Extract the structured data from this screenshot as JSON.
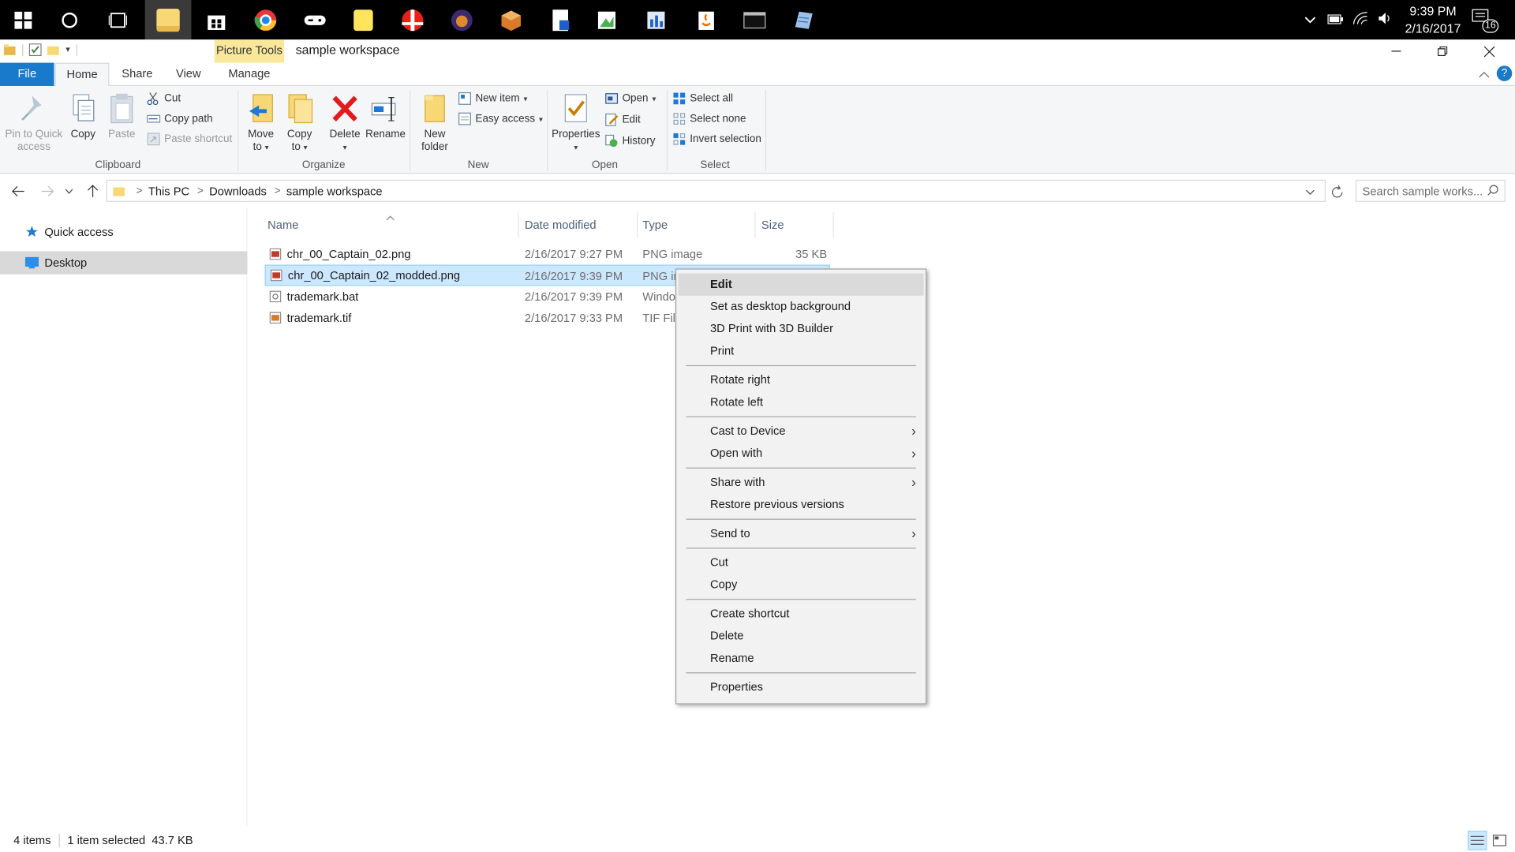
{
  "taskbar": {
    "apps": [
      {
        "icon": "windows-start-icon"
      },
      {
        "icon": "cortana-search-icon"
      },
      {
        "icon": "task-view-icon"
      },
      {
        "icon": "file-explorer-icon",
        "color": "#f8d775"
      },
      {
        "icon": "store-icon"
      },
      {
        "icon": "chrome-icon",
        "color": "#e53935"
      },
      {
        "icon": "game-controller-icon"
      },
      {
        "icon": "sticky-notes-icon",
        "color": "#ffe45c"
      },
      {
        "icon": "smash-app-icon",
        "color": "#e62117"
      },
      {
        "icon": "game-app-icon",
        "color": "#6b4aa8"
      },
      {
        "icon": "box-app-icon",
        "color": "#d97a2b"
      },
      {
        "icon": "document-app-icon"
      },
      {
        "icon": "image-editor-icon"
      },
      {
        "icon": "chart-app-icon"
      },
      {
        "icon": "java-icon"
      },
      {
        "icon": "terminal-icon"
      },
      {
        "icon": "notepad-icon"
      }
    ],
    "clock_time": "9:39 PM",
    "clock_date": "2/16/2017",
    "notification_count": "16"
  },
  "titlebar": {
    "contextual_tab": "Picture Tools",
    "title": "sample workspace"
  },
  "ribbon_tabs": {
    "file": "File",
    "home": "Home",
    "share": "Share",
    "view": "View",
    "manage": "Manage"
  },
  "ribbon": {
    "clipboard": {
      "label": "Clipboard",
      "pin_line1": "Pin to Quick",
      "pin_line2": "access",
      "copy": "Copy",
      "paste": "Paste",
      "cut": "Cut",
      "copy_path": "Copy path",
      "paste_shortcut": "Paste shortcut"
    },
    "organize": {
      "label": "Organize",
      "move_line1": "Move",
      "move_line2": "to",
      "copy_line1": "Copy",
      "copy_line2": "to",
      "delete": "Delete",
      "rename": "Rename"
    },
    "new": {
      "label": "New",
      "folder_line1": "New",
      "folder_line2": "folder",
      "new_item": "New item",
      "easy_access": "Easy access"
    },
    "open": {
      "label": "Open",
      "properties": "Properties",
      "open": "Open",
      "edit": "Edit",
      "history": "History"
    },
    "select": {
      "label": "Select",
      "select_all": "Select all",
      "select_none": "Select none",
      "invert": "Invert selection"
    }
  },
  "address": {
    "crumbs": [
      "This PC",
      "Downloads",
      "sample workspace"
    ],
    "search_placeholder": "Search sample works..."
  },
  "navpane": {
    "quick_access": "Quick access",
    "desktop": "Desktop"
  },
  "columns": {
    "name": "Name",
    "date": "Date modified",
    "type": "Type",
    "size": "Size"
  },
  "files": [
    {
      "name": "chr_00_Captain_02.png",
      "date": "2/16/2017 9:27 PM",
      "type": "PNG image",
      "size": "35 KB"
    },
    {
      "name": "chr_00_Captain_02_modded.png",
      "date": "2/16/2017 9:39 PM",
      "type": "PNG in",
      "size": ""
    },
    {
      "name": "trademark.bat",
      "date": "2/16/2017 9:39 PM",
      "type": "Windo",
      "size": ""
    },
    {
      "name": "trademark.tif",
      "date": "2/16/2017 9:33 PM",
      "type": "TIF File",
      "size": ""
    }
  ],
  "context_menu": {
    "edit": "Edit",
    "set_background": "Set as desktop background",
    "print_3d": "3D Print with 3D Builder",
    "print": "Print",
    "rotate_right": "Rotate right",
    "rotate_left": "Rotate left",
    "cast": "Cast to Device",
    "open_with": "Open with",
    "share_with": "Share with",
    "restore": "Restore previous versions",
    "send_to": "Send to",
    "cut": "Cut",
    "copy": "Copy",
    "create_shortcut": "Create shortcut",
    "delete": "Delete",
    "rename": "Rename",
    "properties": "Properties"
  },
  "status": {
    "items": "4 items",
    "selected": "1 item selected  43.7 KB"
  },
  "colors": {
    "accent": "#1979ca",
    "selection": "#cce8ff",
    "picture_tools": "#f9e79a"
  }
}
